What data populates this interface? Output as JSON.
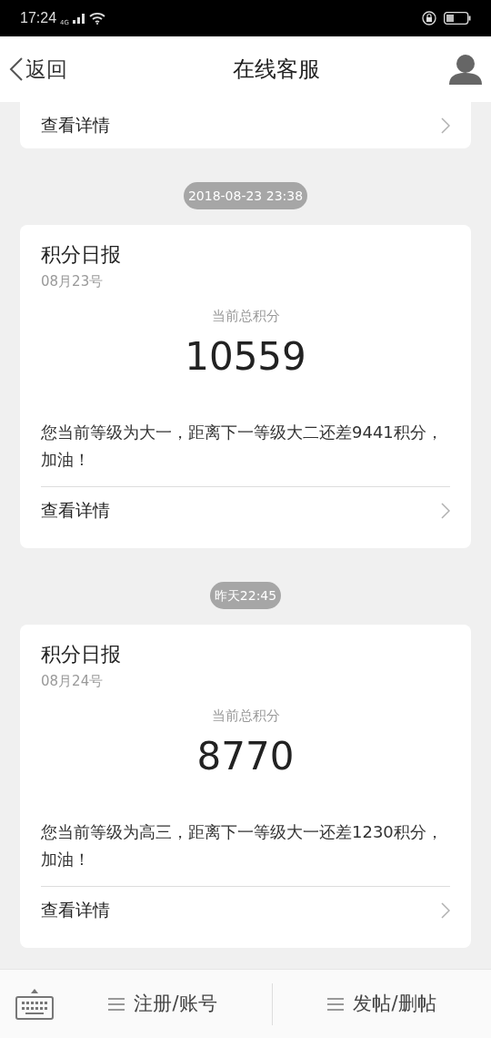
{
  "status_bar": {
    "time": "17:24",
    "network": "4G"
  },
  "header": {
    "back": "返回",
    "title": "在线客服"
  },
  "top_card": {
    "link": "查看详情"
  },
  "messages": [
    {
      "time": "2018-08-23 23:38",
      "title": "积分日报",
      "date": "08月23号",
      "label": "当前总积分",
      "points": "10559",
      "text": "您当前等级为大一，距离下一等级大二还差9441积分，加油！",
      "link": "查看详情"
    },
    {
      "time": "昨天22:45",
      "title": "积分日报",
      "date": "08月24号",
      "label": "当前总积分",
      "points": "8770",
      "text": "您当前等级为高三，距离下一等级大一还差1230积分，加油！",
      "link": "查看详情"
    }
  ],
  "bottom_bar": {
    "menus": [
      "注册/账号",
      "发帖/删帖"
    ]
  }
}
